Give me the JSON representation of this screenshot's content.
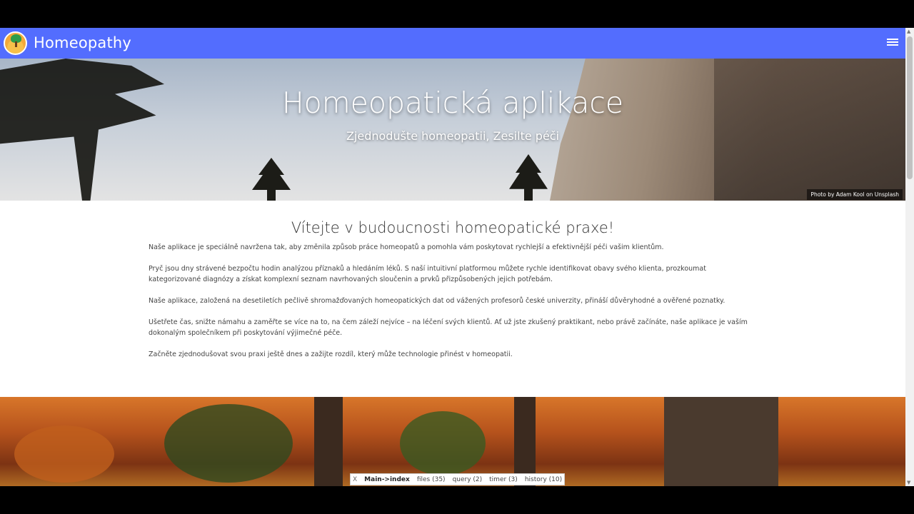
{
  "navbar": {
    "brand": "Homeopathy",
    "accent": "#536dfe"
  },
  "hero": {
    "title": "Homeopatická aplikace",
    "subtitle": "Zjednodušte homeopatii, Zesilte péči",
    "credit": "Photo by Adam Kool on Unsplash"
  },
  "content": {
    "heading": "Vítejte v budoucnosti homeopatické praxe!",
    "paragraphs": [
      "Naše aplikace je speciálně navržena tak, aby změnila způsob práce homeopatů a pomohla vám poskytovat rychlejší a efektivnější péči vašim klientům.",
      "Pryč jsou dny strávené bezpočtu hodin analýzou příznaků a hledáním léků. S naší intuitivní platformou můžete rychle identifikovat obavy svého klienta, prozkoumat kategorizované diagnózy a získat komplexní seznam navrhovaných sloučenin a prvků přizpůsobených jejich potřebám.",
      "Naše aplikace, založená na desetiletích pečlivě shromažďovaných homeopatických dat od vážených profesorů české univerzity, přináší důvěryhodné a ověřené poznatky.",
      "Ušetřete čas, snižte námahu a zaměřte se více na to, na čem záleží nejvíce – na léčení svých klientů. Ať už jste zkušený praktikant, nebo právě začínáte, naše aplikace je vaším dokonalým společníkem při poskytování výjimečné péče.",
      "Začněte zjednodušovat svou praxi ještě dnes a zažijte rozdíl, který může technologie přinést v homeopatii."
    ]
  },
  "debugbar": {
    "close": "X",
    "path": "Main->index",
    "files": "files (35)",
    "query": "query (2)",
    "timer": "timer (3)",
    "history": "history (10)"
  }
}
